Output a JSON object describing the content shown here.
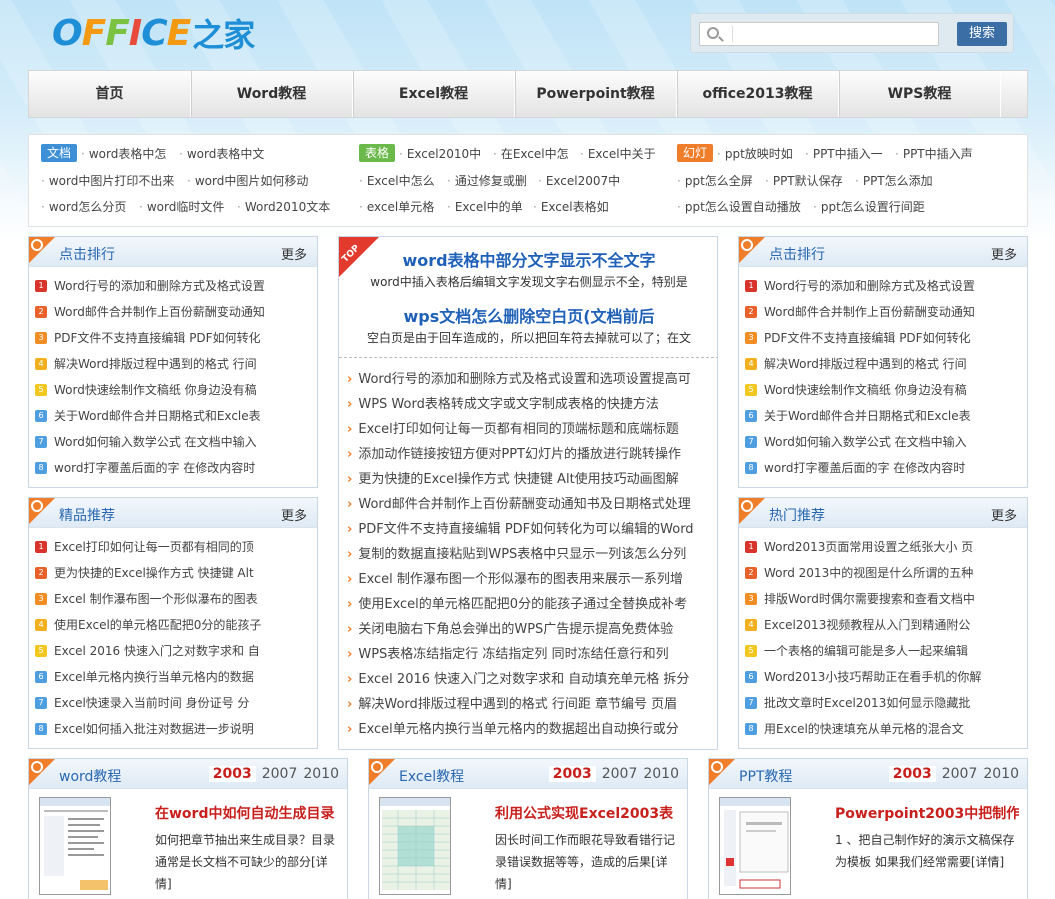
{
  "brand": {
    "logo_letters": [
      "O",
      "F",
      "F",
      "I",
      "C",
      "E"
    ],
    "logo_suffix": "之家"
  },
  "search": {
    "placeholder": "",
    "button": "搜索"
  },
  "nav": [
    "首页",
    "Word教程",
    "Excel教程",
    "Powerpoint教程",
    "office2013教程",
    "WPS教程"
  ],
  "tags": {
    "word_badge": "文档",
    "excel_badge": "表格",
    "ppt_badge": "幻灯",
    "row1": [
      "word表格中怎",
      "word表格中文",
      "Excel2010中",
      "在Excel中怎",
      "Excel中关于",
      "ppt放映时如",
      "PPT中插入一",
      "PPT中插入声"
    ],
    "row2": [
      "word中图片打印不出来",
      "word中图片如何移动",
      "Excel中怎么",
      "通过修复或删",
      "Excel2007中",
      "ppt怎么全屏",
      "PPT默认保存",
      "PPT怎么添加"
    ],
    "row3": [
      "word怎么分页",
      "word临时文件",
      "Word2010文本",
      "excel单元格",
      "Excel中的单",
      "Excel表格如",
      "ppt怎么设置自动播放",
      "ppt怎么设置行间距"
    ]
  },
  "left_rank": {
    "title": "点击排行",
    "more": "更多",
    "items": [
      "Word行号的添加和删除方式及格式设置",
      "Word邮件合并制作上百份薪酬变动通知",
      "PDF文件不支持直接编辑 PDF如何转化",
      "解决Word排版过程中遇到的格式 行间",
      "Word快速绘制作文稿纸 你身边没有稿",
      "关于Word邮件合并日期格式和Excle表",
      "Word如何输入数学公式 在文档中输入",
      "word打字覆盖后面的字 在修改内容时"
    ]
  },
  "left_pick": {
    "title": "精品推荐",
    "more": "更多",
    "items": [
      "Excel打印如何让每一页都有相同的顶",
      "更为快捷的Excel操作方式 快捷键 Alt",
      "Excel 制作瀑布图一个形似瀑布的图表",
      "使用Excel的单元格匹配把0分的能孩子",
      "Excel 2016 快速入门之对数字求和 自",
      "Excel单元格内换行当单元格内的数据",
      "Excel快速录入当前时间 身份证号 分",
      "Excel如何插入批注对数据进一步说明"
    ]
  },
  "center": {
    "top_label": "TOP",
    "headline1": "word表格中部分文字显示不全文字",
    "summary1": "word中插入表格后编辑文字发现文字右侧显示不全，特别是",
    "headline2": "wps文档怎么删除空白页(文档前后",
    "summary2": "空白页是由于回车造成的，所以把回车符去掉就可以了；在文",
    "items": [
      "Word行号的添加和删除方式及格式设置和选项设置提高可",
      "WPS Word表格转成文字或文字制成表格的快捷方法",
      "Excel打印如何让每一页都有相同的顶端标题和底端标题",
      "添加动作链接按钮方便对PPT幻灯片的播放进行跳转操作",
      "更为快捷的Excel操作方式 快捷键 Alt使用技巧动画图解",
      "Word邮件合并制作上百份薪酬变动通知书及日期格式处理",
      "PDF文件不支持直接编辑 PDF如何转化为可以编辑的Word",
      "复制的数据直接粘贴到WPS表格中只显示一列该怎么分列",
      "Excel 制作瀑布图一个形似瀑布的图表用来展示一系列增",
      "使用Excel的单元格匹配把0分的能孩子通过全替换成补考",
      "关闭电脑右下角总会弹出的WPS广告提示提高免费体验",
      "WPS表格冻结指定行 冻结指定列 同时冻结任意行和列",
      "Excel 2016 快速入门之对数字求和 自动填充单元格 拆分",
      "解决Word排版过程中遇到的格式 行间距 章节编号 页眉",
      "Excel单元格内换行当单元格内的数据超出自动换行或分"
    ]
  },
  "right_rank": {
    "title": "点击排行",
    "more": "更多",
    "items": [
      "Word行号的添加和删除方式及格式设置",
      "Word邮件合并制作上百份薪酬变动通知",
      "PDF文件不支持直接编辑 PDF如何转化",
      "解决Word排版过程中遇到的格式 行间",
      "Word快速绘制作文稿纸 你身边没有稿",
      "关于Word邮件合并日期格式和Excle表",
      "Word如何输入数学公式 在文档中输入",
      "word打字覆盖后面的字 在修改内容时"
    ]
  },
  "right_hot": {
    "title": "热门推荐",
    "more": "更多",
    "items": [
      "Word2013页面常用设置之纸张大小 页",
      "Word 2013中的视图是什么所谓的五种",
      "排版Word时偶尔需要搜索和查看文档中",
      "Excel2013视频教程从入门到精通附公",
      "一个表格的编辑可能是多人一起来编辑",
      "Word2013小技巧帮助正在看手机的你解",
      "批改文章时Excel2013如何显示隐藏批",
      "用Excel的快速填充从单元格的混合文"
    ]
  },
  "bottom": [
    {
      "title": "word教程",
      "years": [
        "2003",
        "2007",
        "2010"
      ],
      "article": "在word中如何自动生成目录",
      "desc": "如何把章节抽出来生成目录？目录通常是长文档不可缺少的部分[详情]"
    },
    {
      "title": "Excel教程",
      "years": [
        "2003",
        "2007",
        "2010"
      ],
      "article": "利用公式实现Excel2003表",
      "desc": "因长时间工作而眼花导致看错行记录错误数据等等，造成的后果[详情]"
    },
    {
      "title": "PPT教程",
      "years": [
        "2003",
        "2007",
        "2010"
      ],
      "article": "Powerpoint2003中把制作",
      "desc": "1 、把自己制作好的演示文稿保存为模板 如果我们经常需要[详情]"
    }
  ],
  "colors": {
    "brand_blue": "#1e8fd6",
    "title_blue": "#1f60b8",
    "accent_orange": "#f07d2a",
    "red": "#c8201c"
  }
}
